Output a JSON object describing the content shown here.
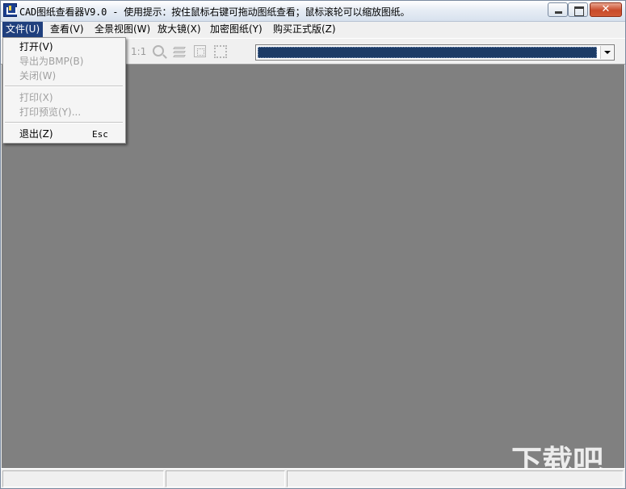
{
  "window": {
    "title": "CAD图纸查看器V9.0 - 使用提示：按住鼠标右键可拖动图纸查看；鼠标滚轮可以缩放图纸。",
    "close_glyph": "✕"
  },
  "menubar": {
    "items": [
      {
        "label": "文件(U)",
        "active": true
      },
      {
        "label": "查看(V)"
      },
      {
        "label": "全景视图(W)"
      },
      {
        "label": "放大镜(X)"
      },
      {
        "label": "加密图纸(Y)"
      },
      {
        "label": "购买正式版(Z)"
      }
    ]
  },
  "file_menu": {
    "items": [
      {
        "label": "打开(V)",
        "enabled": true
      },
      {
        "label": "导出为BMP(B)",
        "enabled": false
      },
      {
        "label": "关闭(W)",
        "enabled": false
      },
      {
        "label": "打印(X)",
        "enabled": false
      },
      {
        "label": "打印预览(Y)...",
        "enabled": false
      },
      {
        "label": "退出(Z)",
        "enabled": true,
        "shortcut": "Esc"
      }
    ]
  },
  "toolbar": {
    "actual_size_label": "1:1",
    "icons": [
      "zoom-icon",
      "layers-icon",
      "fit-window-icon",
      "select-region-icon"
    ],
    "layer_combo_selected": ""
  },
  "statusbar": {
    "panes": [
      "",
      "",
      ""
    ]
  },
  "watermark": {
    "text": "下载吧",
    "url": "www.xiazaiba.com"
  },
  "colors": {
    "canvas": "#808080",
    "menu_active": "#1f3f7d",
    "combo_fill": "#1c3b66"
  }
}
